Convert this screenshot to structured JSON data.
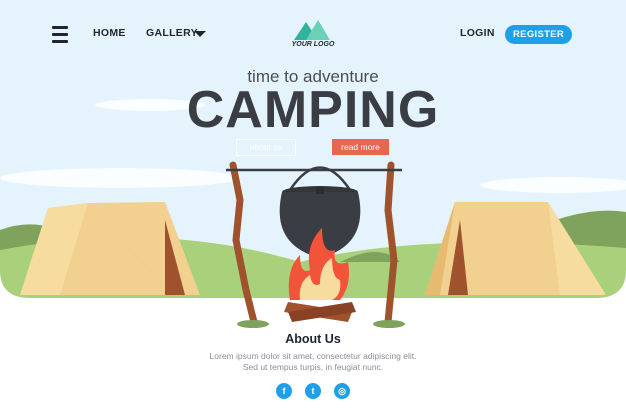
{
  "nav": {
    "home": "HOME",
    "gallery": "GALLERY",
    "login": "LOGIN",
    "register": "REGISTER"
  },
  "logo": {
    "text": "YOUR LOGO"
  },
  "hero": {
    "tagline": "time to adventure",
    "headline": "CAMPING",
    "about_button": "about us",
    "read_more_button": "read more"
  },
  "about": {
    "title": "About Us",
    "text": "Lorem ipsum dolor sit amet, consectetur adipiscing elit. Sed ut tempus turpis, in feugiat nunc."
  },
  "social": {
    "facebook": "f",
    "twitter": "t",
    "instagram": "◎"
  },
  "colors": {
    "sky": "#e4f3fc",
    "accent_blue": "#1ea0e8",
    "read_more": "#e8664f",
    "tent": "#f2d08f",
    "ground": "#a9d07b",
    "pole": "#a0522d"
  }
}
